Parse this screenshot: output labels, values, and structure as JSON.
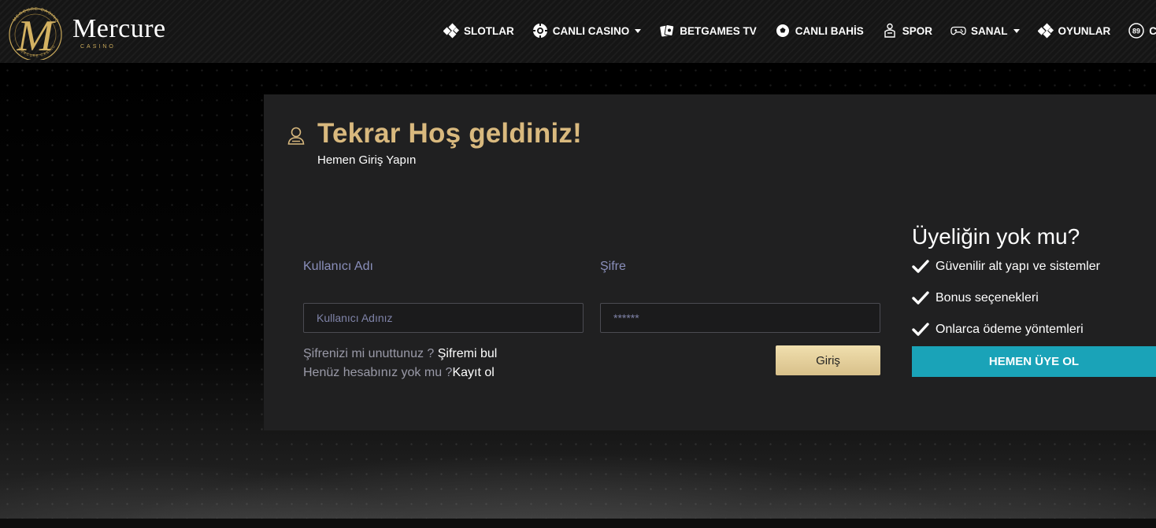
{
  "brand": {
    "name": "Mercure",
    "tagline": "CASINO",
    "ring_text_top": "MERCURE CASINO",
    "ring_text_bottom": "MERCURE CASINO",
    "monogram": "M"
  },
  "nav": [
    {
      "label": "SLOTLAR",
      "icon": "dice-icon",
      "dropdown": false
    },
    {
      "label": "CANLI CASINO",
      "icon": "roulette-chip-icon",
      "dropdown": true
    },
    {
      "label": "BETGAMES TV",
      "icon": "cards-icon",
      "dropdown": false
    },
    {
      "label": "CANLI BAHİS",
      "icon": "soccer-ball-icon",
      "dropdown": false
    },
    {
      "label": "SPOR",
      "icon": "sport-player-icon",
      "dropdown": false
    },
    {
      "label": "SANAL",
      "icon": "gamepad-icon",
      "dropdown": true
    },
    {
      "label": "OYUNLAR",
      "icon": "dice-icon",
      "dropdown": false
    },
    {
      "label": "CANL",
      "icon": "bingo-ball-icon",
      "dropdown": false,
      "badge": "89"
    }
  ],
  "login": {
    "title": "Tekrar Hoş geldiniz!",
    "subtitle": "Hemen Giriş Yapın",
    "username_label": "Kullanıcı Adı",
    "username_placeholder": "Kullanıcı Adınız",
    "password_label": "Şifre",
    "password_placeholder": "******",
    "forgot_text": "Şifrenizi mi unuttunuz ? ",
    "forgot_link": "Şifremi bul",
    "no_account_text": "Henüz hesabınız yok mu ?",
    "register_link": "Kayıt ol",
    "submit_label": "Giriş"
  },
  "signup": {
    "title": "Üyeliğin yok mu?",
    "features": [
      "Güvenilir alt yapı ve sistemler",
      "Bonus seçenekleri",
      "Onlarca ödeme yöntemleri"
    ],
    "button_label": "HEMEN ÜYE OL"
  },
  "colors": {
    "gold": "#d9b97e",
    "teal": "#1aa3b8",
    "panel": "#202021",
    "label": "#8a8fbb"
  }
}
